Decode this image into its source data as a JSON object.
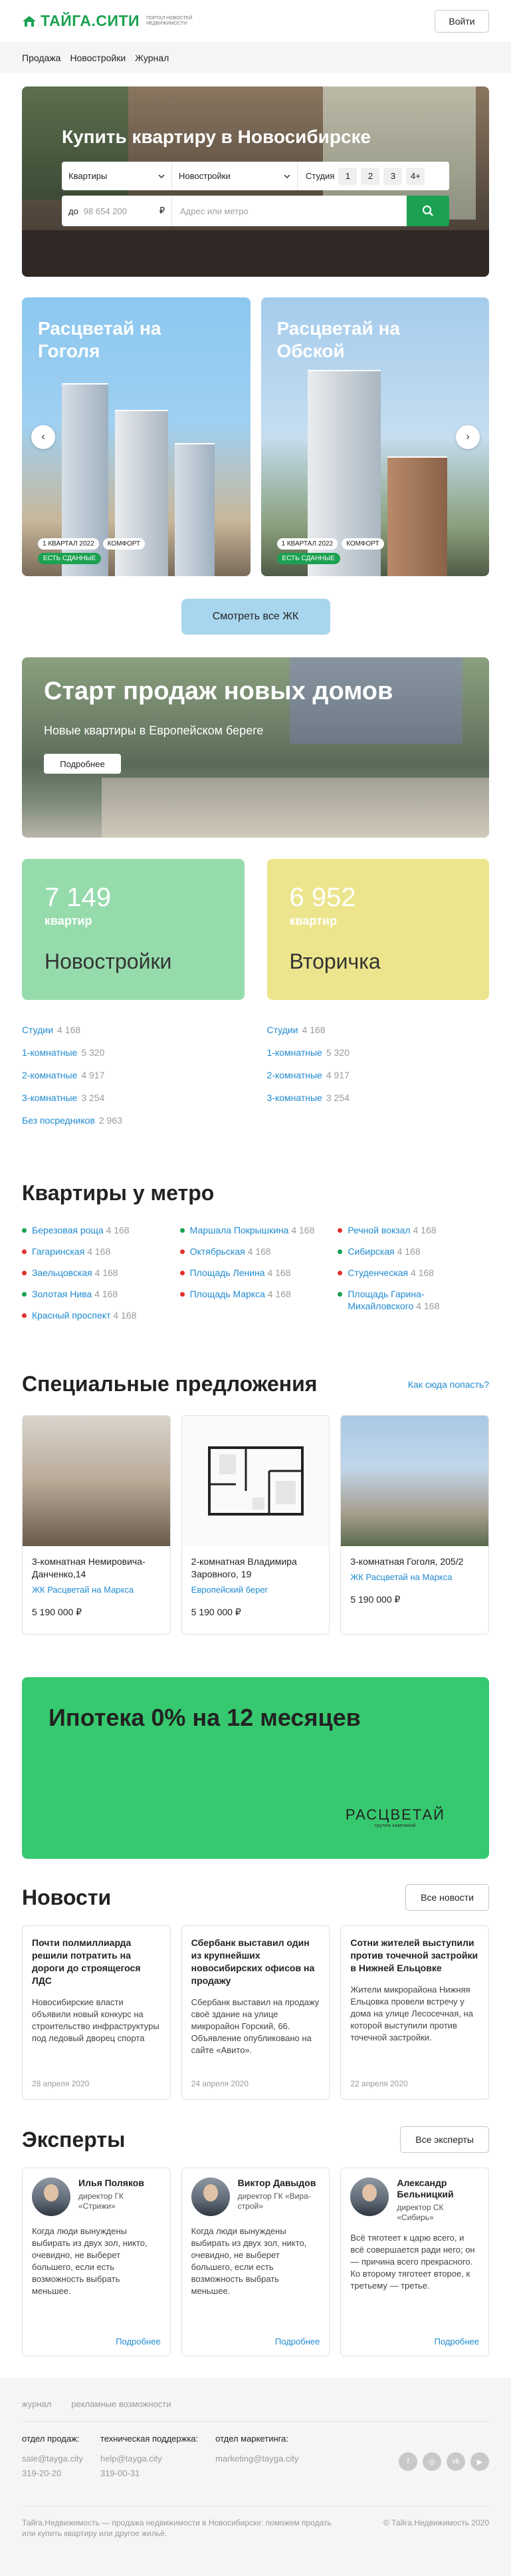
{
  "header": {
    "logo": "ТАЙГА.СИТИ",
    "logo_sub": "ПОРТАЛ НОВОСТЕЙ НЕДВИЖИМОСТИ",
    "login": "Войти"
  },
  "nav": [
    "Продажа",
    "Новостройки",
    "Журнал"
  ],
  "hero": {
    "title": "Купить квартиру в Новосибирске",
    "type_select": "Квартиры",
    "market_select": "Новостройки",
    "rooms_label": "Студия",
    "rooms": [
      "1",
      "2",
      "3",
      "4+"
    ],
    "price_prefix": "до",
    "price_value": "98 654 200",
    "currency": "₽",
    "address_placeholder": "Адрес или метро"
  },
  "complexes": [
    {
      "name": "Расцветай на Гоголя",
      "quarter": "1 КВАРТАЛ 2022",
      "class": "КОМФОРТ",
      "status": "ЕСТЬ СДАННЫЕ"
    },
    {
      "name": "Расцветай на Обской",
      "quarter": "1 КВАРТАЛ 2022",
      "class": "КОМФОРТ",
      "status": "ЕСТЬ СДАННЫЕ"
    }
  ],
  "all_complexes": "Смотреть все ЖК",
  "banner": {
    "title": "Старт продаж новых домов",
    "subtitle": "Новые квартиры в Европейском береге",
    "more": "Подробнее"
  },
  "stats": [
    {
      "count": "7 149",
      "unit": "квартир",
      "name": "Новостройки",
      "items": [
        {
          "label": "Студии",
          "count": "4 168"
        },
        {
          "label": "1-комнатные",
          "count": "5 320"
        },
        {
          "label": "2-комнатные",
          "count": "4 917"
        },
        {
          "label": "3-комнатные",
          "count": "3 254"
        },
        {
          "label": "Без посредников",
          "count": "2 963"
        }
      ]
    },
    {
      "count": "6 952",
      "unit": "квартир",
      "name": "Вторичка",
      "items": [
        {
          "label": "Студии",
          "count": "4 168"
        },
        {
          "label": "1-комнатные",
          "count": "5 320"
        },
        {
          "label": "2-комнатные",
          "count": "4 917"
        },
        {
          "label": "3-комнатные",
          "count": "3 254"
        }
      ]
    }
  ],
  "metro": {
    "title": "Квартиры у метро",
    "columns": [
      [
        {
          "name": "Березовая роща",
          "count": "4 168",
          "line": "green"
        },
        {
          "name": "Гагаринская",
          "count": "4 168",
          "line": "red"
        },
        {
          "name": "Заельцовская",
          "count": "4 168",
          "line": "red"
        },
        {
          "name": "Золотая Нива",
          "count": "4 168",
          "line": "green"
        },
        {
          "name": "Красный проспект",
          "count": "4 168",
          "line": "red"
        }
      ],
      [
        {
          "name": "Маршала Покрышкина",
          "count": "4 168",
          "line": "green"
        },
        {
          "name": "Октябрьская",
          "count": "4 168",
          "line": "red"
        },
        {
          "name": "Площадь Ленина",
          "count": "4 168",
          "line": "red"
        },
        {
          "name": "Площадь Маркса",
          "count": "4 168",
          "line": "red"
        }
      ],
      [
        {
          "name": "Речной вокзал",
          "count": "4 168",
          "line": "red"
        },
        {
          "name": "Сибирская",
          "count": "4 168",
          "line": "green"
        },
        {
          "name": "Студенческая",
          "count": "4 168",
          "line": "red"
        },
        {
          "name": "Площадь Гарина-Михайловского",
          "count": "4 168",
          "line": "green"
        }
      ]
    ]
  },
  "special": {
    "title": "Специальные предложения",
    "how_to": "Как сюда попасть?",
    "offers": [
      {
        "title": "3-комнатная Немировича-Данченко,14",
        "complex": "ЖК Расцветай на Маркса",
        "price": "5 190 000 ₽"
      },
      {
        "title": "2-комнатная Владимира Заровного, 19",
        "complex": "Европейский берег",
        "price": "5 190 000 ₽"
      },
      {
        "title": "3-комнатная Гоголя, 205/2",
        "complex": "ЖК Расцветай на Маркса",
        "price": "5 190 000 ₽"
      }
    ]
  },
  "mortgage": {
    "title": "Ипотека 0% на 12 месяцев",
    "brand": "РАСЦВЕТАЙ",
    "brand_sub": "группа компаний"
  },
  "news": {
    "title": "Новости",
    "all": "Все новости",
    "items": [
      {
        "title": "Почти полмиллиарда решили потратить на дороги до строящегося ЛДС",
        "text": "Новосибирские власти объявили новый конкурс на строительство инфраструктуры под ледовый дворец спорта",
        "date": "28 апреля 2020"
      },
      {
        "title": "Сбербанк выставил один из крупнейших новосибирских офисов на продажу",
        "text": "Сбербанк выставил на продажу своё здание на улице микрорайон Горский, 66. Объявление опубликовано на сайте «Авито».",
        "date": "24 апреля 2020"
      },
      {
        "title": "Сотни жителей выступили против точечной застройки в Нижней Ельцовке",
        "text": "Жители микрорайона Нижняя Ельцовка провели встречу у дома на улице Лесосечная, на которой выступили против точечной застройки.",
        "date": "22 апреля 2020"
      }
    ]
  },
  "experts": {
    "title": "Эксперты",
    "all": "Все эксперты",
    "items": [
      {
        "name": "Илья Поляков",
        "role": "директор ГК «Стрижи»",
        "text": "Когда люди вынуждены выбирать из двух зол, никто, очевидно, не выберет большего, если есть возможность выбрать меньшее.",
        "more": "Подробнее"
      },
      {
        "name": "Виктор Давыдов",
        "role": "директор ГК «Вира-строй»",
        "text": "Когда люди вынуждены выбирать из двух зол, никто, очевидно, не выберет большего, если есть возможность выбрать меньшее.",
        "more": "Подробнее"
      },
      {
        "name": "Александр Бельницкий",
        "role": "директор СК «Сибирь»",
        "text": "Всё тяготеет к царю всего, и всё совершается ради него; он — причина всего прекрасного. Ко второму тяготеет второе, к третьему — третье.",
        "more": "Подробнее"
      }
    ]
  },
  "footer": {
    "links": [
      "журнал",
      "рекламные возможности"
    ],
    "cols": [
      {
        "title": "отдел продаж:",
        "email": "sale@tayga.city",
        "phone": "319-20-20"
      },
      {
        "title": "техническая поддержка:",
        "email": "help@tayga.city",
        "phone": "319-00-31"
      },
      {
        "title": "отдел маркетинга:",
        "email": "marketing@tayga.city",
        "phone": ""
      }
    ],
    "social": [
      "facebook-icon",
      "instagram-icon",
      "vk-icon",
      "youtube-icon"
    ],
    "about": "Тайга.Недвижимость — продажа недвижимости в Новосибирске: поможем продать или купить квартиру или другое жильё.",
    "copyright": "© Тайга.Недвижимость 2020"
  },
  "colors": {
    "brand": "#1ba151",
    "link": "#1f8ad0",
    "new_card": "#96dbac",
    "resale_card": "#ece58d",
    "mortgage": "#37c96f"
  }
}
